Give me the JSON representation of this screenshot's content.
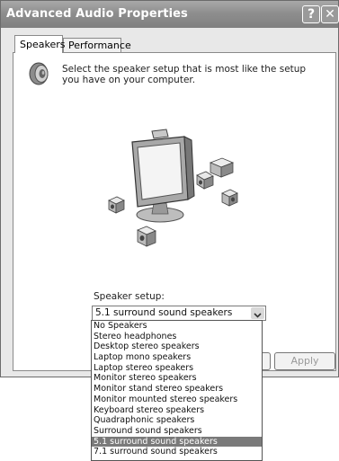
{
  "window": {
    "title": "Advanced Audio Properties",
    "help_glyph": "?",
    "close_glyph": "✕"
  },
  "tabs": [
    {
      "label": "Speakers",
      "active": true
    },
    {
      "label": "Performance",
      "active": false
    }
  ],
  "speakers_tab": {
    "icon": "speaker-icon",
    "instructions": "Select the speaker setup that is most like the setup you have on your computer.",
    "setup_label": "Speaker setup:",
    "selected_value": "5.1 surround sound speakers",
    "options": [
      "No Speakers",
      "Stereo headphones",
      "Desktop stereo speakers",
      "Laptop mono speakers",
      "Laptop stereo speakers",
      "Monitor stereo speakers",
      "Monitor stand stereo speakers",
      "Monitor mounted stereo speakers",
      "Keyboard stereo speakers",
      "Quadraphonic speakers",
      "Surround sound speakers",
      "5.1 surround sound speakers",
      "7.1 surround sound speakers"
    ]
  },
  "buttons": {
    "apply": "Apply"
  }
}
